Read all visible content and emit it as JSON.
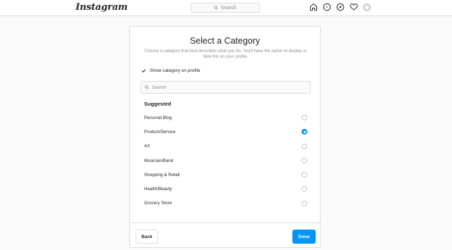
{
  "header": {
    "logo": "Instagram",
    "search_placeholder": "Search"
  },
  "dialog": {
    "title": "Select a Category",
    "subtitle": "Choose a category that best describes what you do. You'll have the option to display or hide this on your profile.",
    "show_category_label": "Show category on profile",
    "show_category_checked": true,
    "search_placeholder": "Search",
    "suggested_heading": "Suggested",
    "categories": [
      {
        "label": "Personal Blog",
        "selected": false
      },
      {
        "label": "Product/Service",
        "selected": true
      },
      {
        "label": "Art",
        "selected": false
      },
      {
        "label": "Musician/Band",
        "selected": false
      },
      {
        "label": "Shopping & Retail",
        "selected": false
      },
      {
        "label": "Health/Beauty",
        "selected": false
      },
      {
        "label": "Grocery Store",
        "selected": false
      }
    ],
    "back_label": "Back",
    "done_label": "Done"
  },
  "colors": {
    "accent": "#0095f6",
    "border": "#dbdbdb",
    "muted_text": "#8e8e8e",
    "background": "#fafafa"
  }
}
